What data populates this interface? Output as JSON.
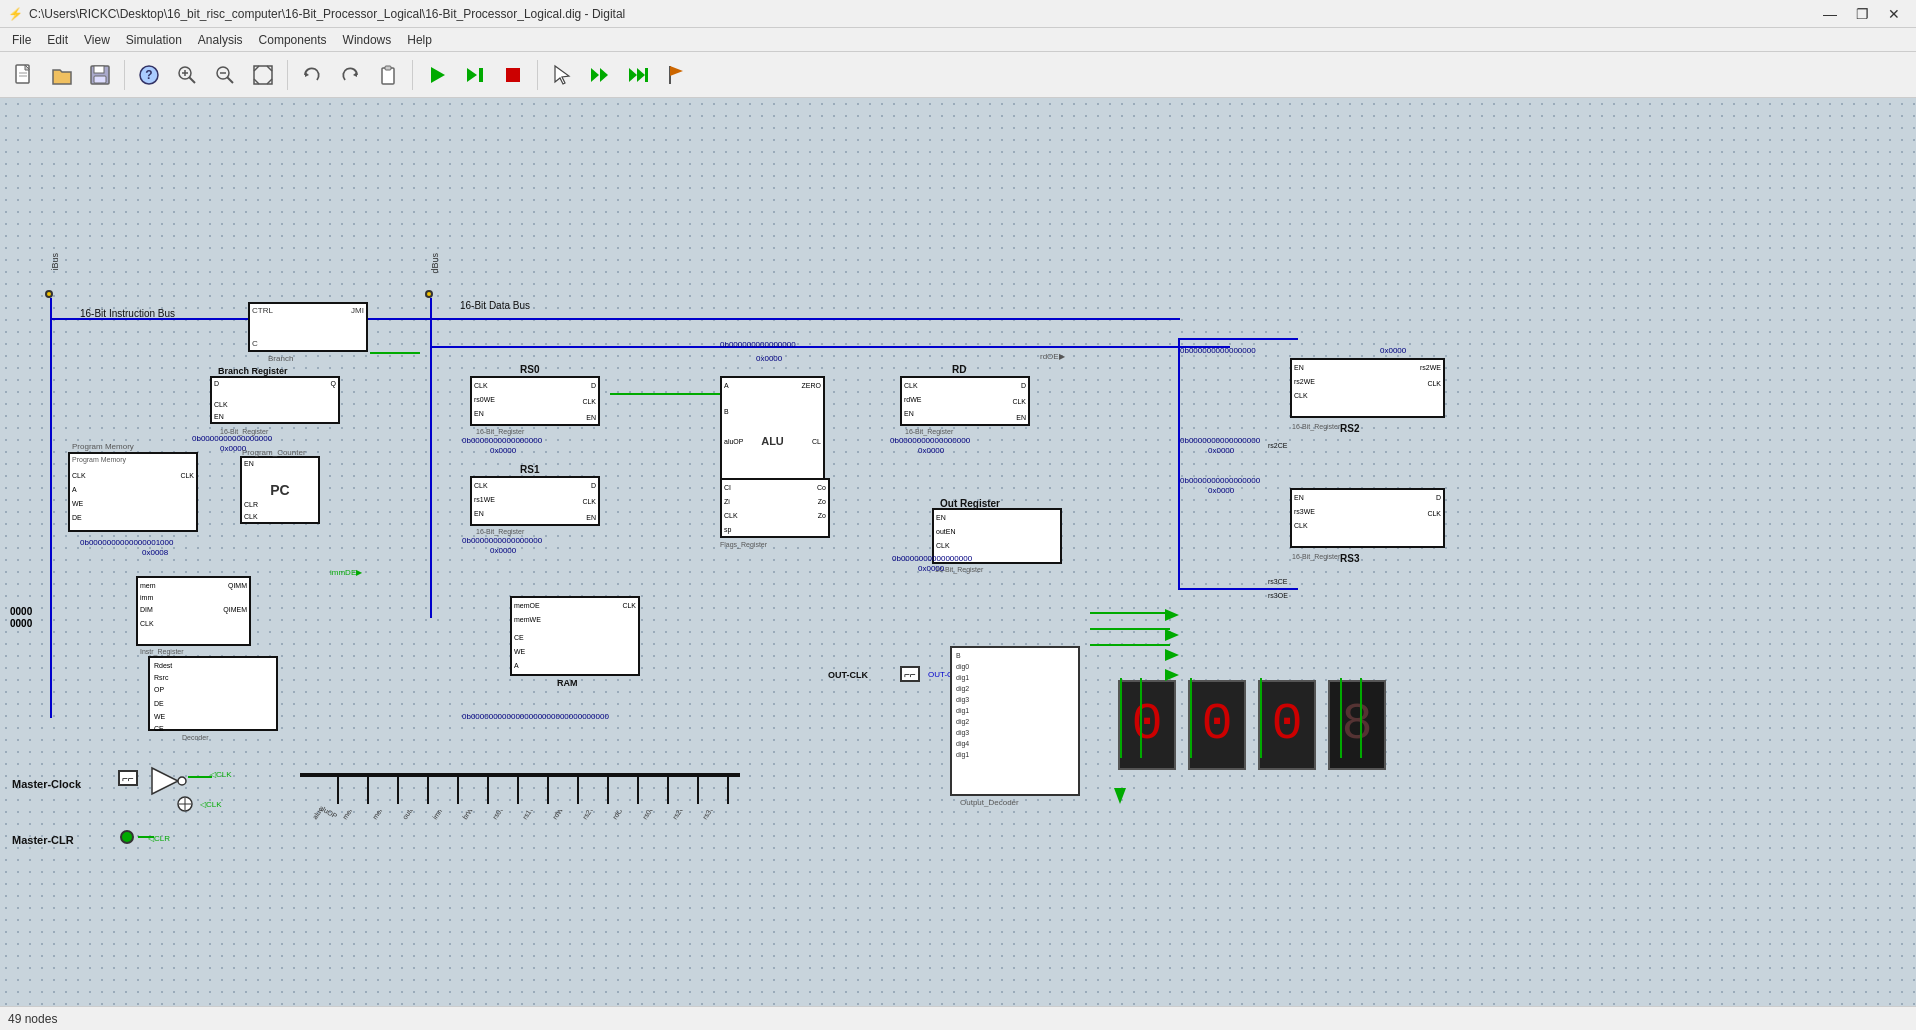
{
  "titlebar": {
    "title": "C:\\Users\\RICKC\\Desktop\\16_bit_risc_computer\\16-Bit_Processor_Logical\\16-Bit_Processor_Logical.dig - Digital",
    "minimize": "—",
    "restore": "❐",
    "close": "✕"
  },
  "menubar": {
    "items": [
      "File",
      "Edit",
      "View",
      "Simulation",
      "Analysis",
      "Components",
      "Windows",
      "Help"
    ]
  },
  "toolbar": {
    "buttons": [
      {
        "name": "new",
        "icon": "📄"
      },
      {
        "name": "open",
        "icon": "📂"
      },
      {
        "name": "save",
        "icon": "💾"
      },
      {
        "name": "help",
        "icon": "❓"
      },
      {
        "name": "zoom-in",
        "icon": "🔍+"
      },
      {
        "name": "zoom-out",
        "icon": "🔍-"
      },
      {
        "name": "zoom-fit",
        "icon": "⊞"
      },
      {
        "name": "undo",
        "icon": "↩"
      },
      {
        "name": "redo",
        "icon": "↪"
      },
      {
        "name": "copy",
        "icon": "📋"
      },
      {
        "name": "play",
        "icon": "▶"
      },
      {
        "name": "step",
        "icon": "⏭"
      },
      {
        "name": "stop",
        "icon": "⏹"
      },
      {
        "name": "cursor",
        "icon": "↖"
      },
      {
        "name": "run-fast",
        "icon": "⏩"
      },
      {
        "name": "run-step2",
        "icon": "⏭⏭"
      },
      {
        "name": "flag",
        "icon": "⚑"
      }
    ]
  },
  "canvas": {
    "components": {
      "ibus_label": "iBus",
      "dbus_label": "dBus",
      "instruction_bus_label": "16-Bit Instruction Bus",
      "data_bus_label": "16-Bit Data Bus",
      "branch_register_label": "Branch Register",
      "rs0_label": "RS0",
      "rs1_label": "RS1",
      "rdo_label": "RD",
      "rs2_label": "RS2",
      "rs3_label": "RS3",
      "alu_label": "ALU",
      "flags_register_label": "Flags_Register",
      "out_register_label": "Out Register",
      "output_decoder_label": "Output_Decoder",
      "program_memory_label": "Program Memory",
      "program_counter_label": "PC",
      "instr_register_label": "Instr_Register",
      "decoder_label": "Decoder",
      "ram_label": "RAM",
      "master_clock_label": "Master-Clock",
      "master_clr_label": "Master-CLR",
      "out_clk_label": "OUT-CLK",
      "values": {
        "v1": "0b0000000000000000",
        "v1h": "0x0000",
        "v2": "0b0000000000000000",
        "v2h": "0x0000",
        "v3": "0b0000000000000000",
        "v3h": "0x0000",
        "v4": "0b0000000000000000",
        "v4h": "0x0000",
        "v5": "0b0000000000000000",
        "v5h": "0x0000",
        "v6": "0b0000000000000000",
        "v6h": "0x0000",
        "v7": "0b0000000000000000",
        "v7h": "0x0000",
        "v8": "0b0000000000000001000",
        "v8h": "0x0008",
        "v9": "0b0000000000000000000000000000000",
        "v10": "0x0000",
        "v10b": "0b0000000000000000",
        "zeros_top": "0b000000000000000",
        "zeros_top2": "0x0000"
      },
      "nodes_count": "49 nodes"
    }
  },
  "statusbar": {
    "text": "49 nodes"
  }
}
